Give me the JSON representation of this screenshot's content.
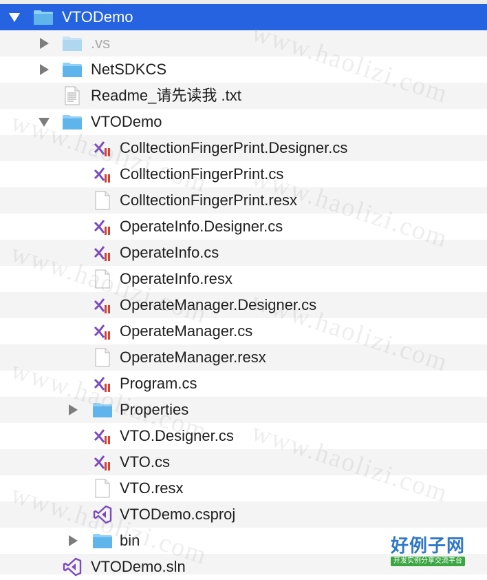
{
  "tree": {
    "items": [
      {
        "label": "VTODemo",
        "type": "folder",
        "expanded": true,
        "selected": true
      },
      {
        "label": ".vs",
        "type": "folder",
        "expanded": false,
        "dimmed": true
      },
      {
        "label": "NetSDKCS",
        "type": "folder",
        "expanded": false
      },
      {
        "label": "Readme_请先读我 .txt",
        "type": "text-file"
      },
      {
        "label": "VTODemo",
        "type": "folder",
        "expanded": true
      },
      {
        "label": "ColltectionFingerPrint.Designer.cs",
        "type": "cs-file"
      },
      {
        "label": "ColltectionFingerPrint.cs",
        "type": "cs-file"
      },
      {
        "label": "ColltectionFingerPrint.resx",
        "type": "blank-file"
      },
      {
        "label": "OperateInfo.Designer.cs",
        "type": "cs-file"
      },
      {
        "label": "OperateInfo.cs",
        "type": "cs-file"
      },
      {
        "label": "OperateInfo.resx",
        "type": "blank-file"
      },
      {
        "label": "OperateManager.Designer.cs",
        "type": "cs-file"
      },
      {
        "label": "OperateManager.cs",
        "type": "cs-file"
      },
      {
        "label": "OperateManager.resx",
        "type": "blank-file"
      },
      {
        "label": "Program.cs",
        "type": "cs-file"
      },
      {
        "label": "Properties",
        "type": "folder",
        "expanded": false
      },
      {
        "label": "VTO.Designer.cs",
        "type": "cs-file"
      },
      {
        "label": "VTO.cs",
        "type": "cs-file"
      },
      {
        "label": "VTO.resx",
        "type": "blank-file"
      },
      {
        "label": "VTODemo.csproj",
        "type": "vs-project"
      },
      {
        "label": "bin",
        "type": "folder",
        "expanded": false
      },
      {
        "label": "VTODemo.sln",
        "type": "vs-project"
      }
    ]
  },
  "watermark": {
    "text": "www.haolizi.com"
  },
  "logo": {
    "main": "好例子网",
    "sub": "开发实例分享交流平台"
  },
  "colors": {
    "selection": "#2563e0",
    "folder": "#5fb4ec",
    "alt_row": "#f4f4f4",
    "vs_purple": "#7a4bbf",
    "cs_red": "#d8412f"
  }
}
